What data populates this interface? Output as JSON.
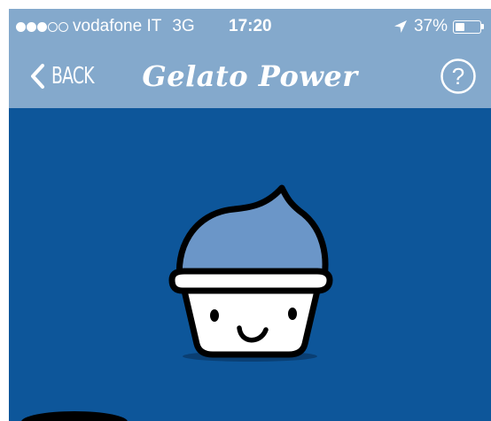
{
  "statusbar": {
    "carrier": "vodafone IT",
    "network": "3G",
    "time": "17:20",
    "battery_percent": "37%",
    "battery_level": 0.37,
    "signal_bars_filled": 3,
    "signal_bars_total": 5
  },
  "navbar": {
    "back_label": "BACK",
    "title": "Gelato Power",
    "help_label": "?"
  },
  "colors": {
    "bar_background": "#84a9cc",
    "content_background": "#0d569a",
    "scoop": "#6b96c8",
    "cup": "#ffffff"
  },
  "icons": {
    "back": "chevron-left-icon",
    "help": "question-circle-icon",
    "location": "location-arrow-icon",
    "battery": "battery-icon"
  }
}
